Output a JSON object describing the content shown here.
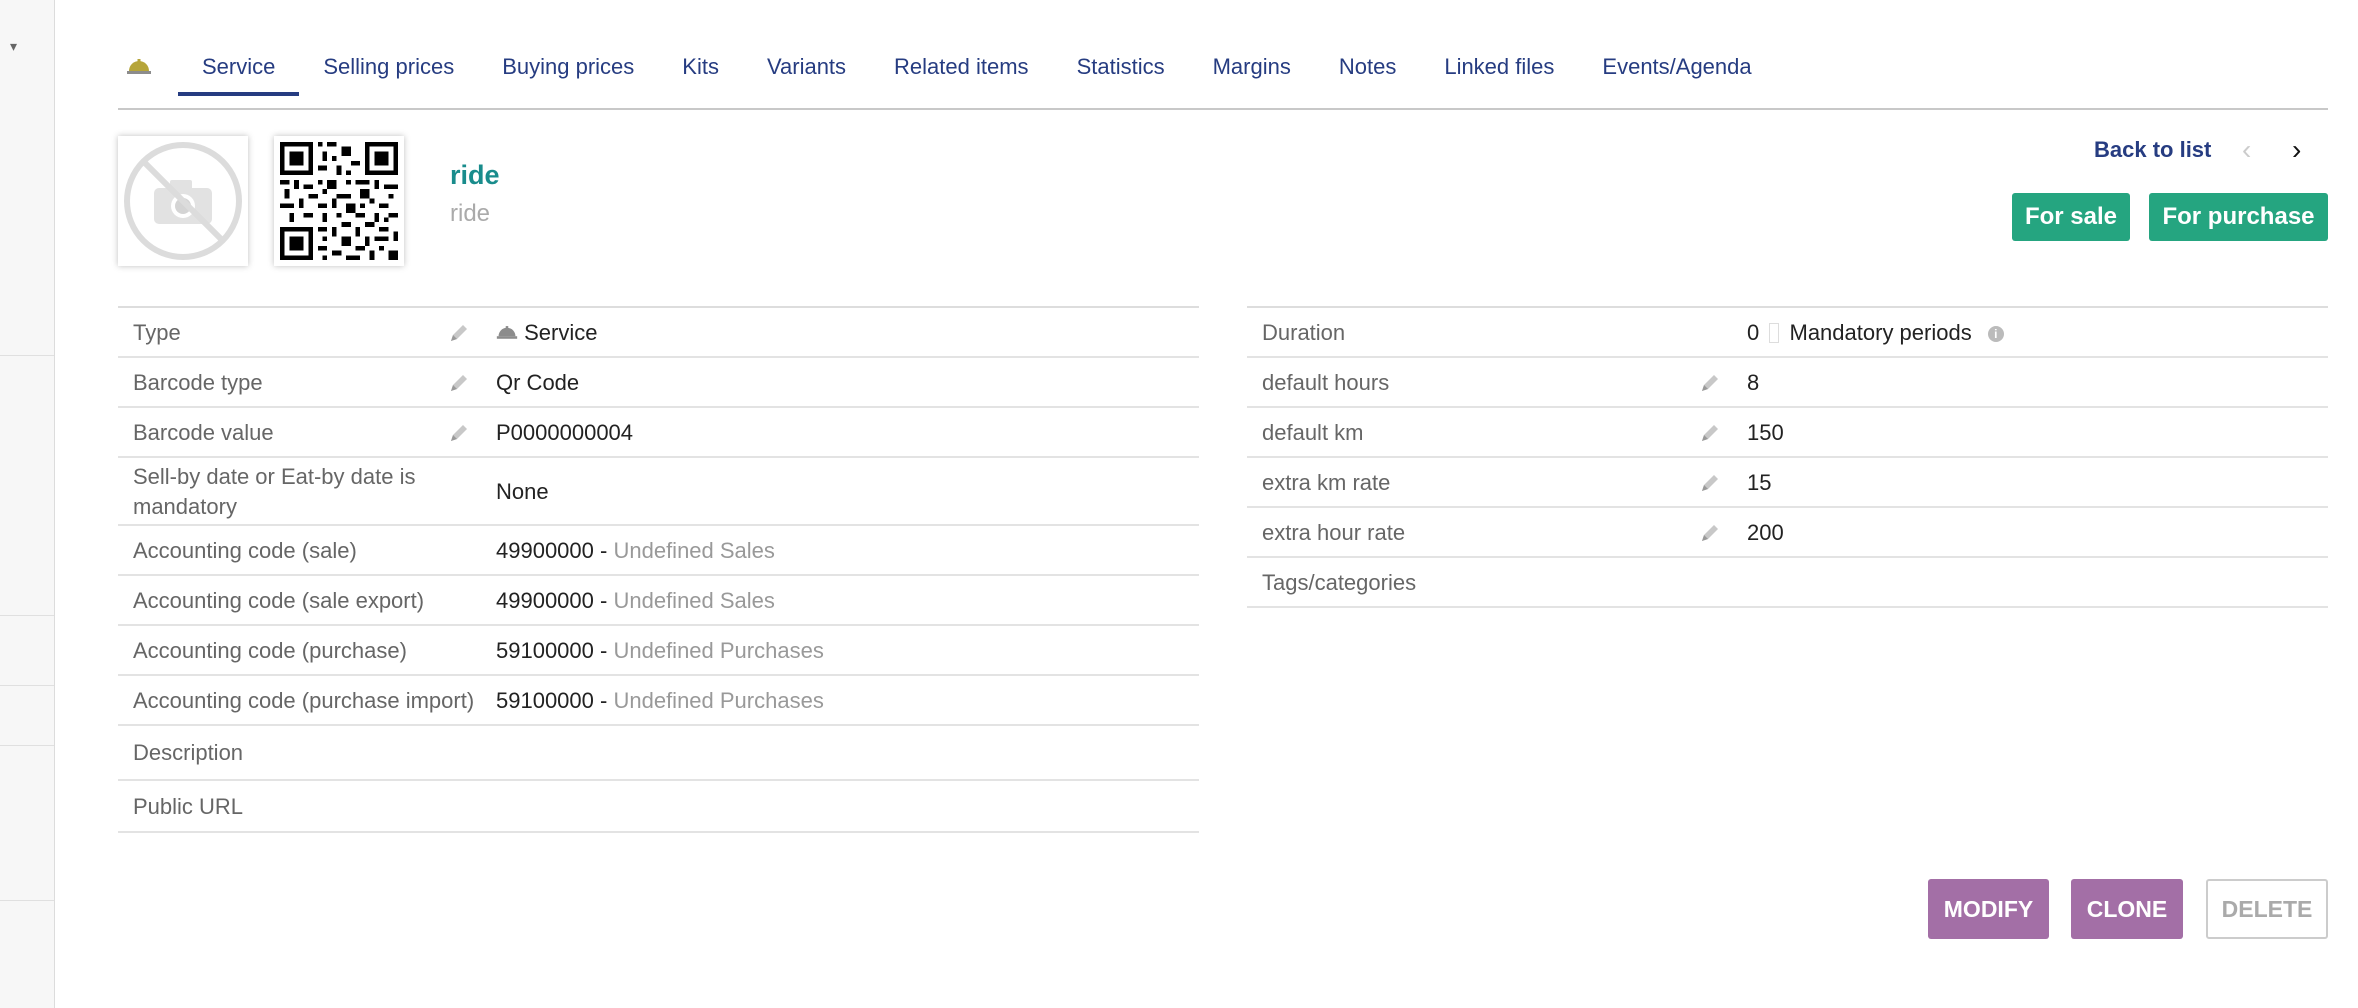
{
  "tabs": {
    "icon": "service-bell-icon",
    "items": [
      "Service",
      "Selling prices",
      "Buying prices",
      "Kits",
      "Variants",
      "Related items",
      "Statistics",
      "Margins",
      "Notes",
      "Linked files",
      "Events/Agenda"
    ],
    "active": "Service"
  },
  "product": {
    "title": "ride",
    "subtitle": "ride",
    "photo_icon": "no-photo-icon",
    "barcode_icon": "qr-code-icon"
  },
  "nav": {
    "back_label": "Back to list",
    "prev_icon": "chevron-left-icon",
    "next_icon": "chevron-right-icon"
  },
  "badges": {
    "for_sale": "For sale",
    "for_purchase": "For purchase",
    "color": "#25a580"
  },
  "left_fields": {
    "type": {
      "label": "Type",
      "value": "Service"
    },
    "barcode_type": {
      "label": "Barcode type",
      "value": "Qr Code"
    },
    "barcode_value": {
      "label": "Barcode value",
      "value": "P0000000004"
    },
    "sellby": {
      "label_line1": "Sell-by date or Eat-by date is",
      "label_line2": "mandatory",
      "value": "None"
    },
    "acc_sale": {
      "label": "Accounting code (sale)",
      "code": "49900000",
      "sep": "-",
      "desc": "Undefined Sales"
    },
    "acc_sale_export": {
      "label": "Accounting code (sale export)",
      "code": "49900000",
      "sep": "-",
      "desc": "Undefined Sales"
    },
    "acc_purchase": {
      "label": "Accounting code (purchase)",
      "code": "59100000",
      "sep": "-",
      "desc": "Undefined Purchases"
    },
    "acc_purchase_import": {
      "label": "Accounting code (purchase import)",
      "code": "59100000",
      "sep": "-",
      "desc": "Undefined Purchases"
    },
    "description": {
      "label": "Description",
      "value": ""
    },
    "public_url": {
      "label": "Public URL",
      "value": ""
    }
  },
  "right_fields": {
    "duration": {
      "label": "Duration",
      "value": "0",
      "mandatory_label": "Mandatory periods"
    },
    "default_hours": {
      "label": "default hours",
      "value": "8"
    },
    "default_km": {
      "label": "default km",
      "value": "150"
    },
    "extra_km_rate": {
      "label": "extra km rate",
      "value": "15"
    },
    "extra_hour_rate": {
      "label": "extra hour rate",
      "value": "200"
    },
    "tags": {
      "label": "Tags/categories",
      "value": ""
    }
  },
  "actions": {
    "modify": "MODIFY",
    "clone": "CLONE",
    "delete": "DELETE",
    "color": "#a36fa6"
  }
}
